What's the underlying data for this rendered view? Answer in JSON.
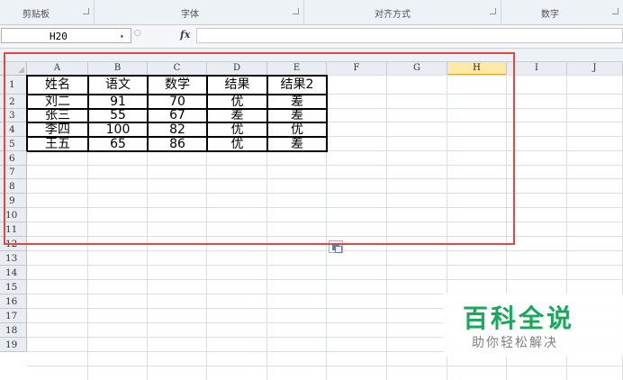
{
  "ribbon": {
    "groups": [
      "剪贴板",
      "字体",
      "对齐方式",
      "数字"
    ]
  },
  "formula_bar": {
    "name_box": "H20",
    "name_box_arrow": "▾",
    "fx_label": "fx",
    "formula": ""
  },
  "grid": {
    "columns": [
      "A",
      "B",
      "C",
      "D",
      "E",
      "F",
      "G",
      "H",
      "I",
      "J"
    ],
    "selected_column": "H",
    "rows": [
      "1",
      "2",
      "3",
      "4",
      "5",
      "6",
      "7",
      "8",
      "9",
      "10",
      "11",
      "12",
      "13",
      "14",
      "15",
      "16",
      "17",
      "18",
      "19"
    ],
    "table": [
      [
        "姓名",
        "语文",
        "数学",
        "结果",
        "结果2"
      ],
      [
        "刘二",
        "91",
        "70",
        "优",
        "差"
      ],
      [
        "张三",
        "55",
        "67",
        "差",
        "差"
      ],
      [
        "李四",
        "100",
        "82",
        "优",
        "优"
      ],
      [
        "王五",
        "65",
        "86",
        "优",
        "差"
      ]
    ]
  },
  "watermark": {
    "title": "百科全说",
    "subtitle": "助你轻松解决"
  },
  "colors": {
    "highlight_box": "#e04848",
    "selected_header": "#ffe9a8",
    "watermark_green": "#16a85b"
  }
}
